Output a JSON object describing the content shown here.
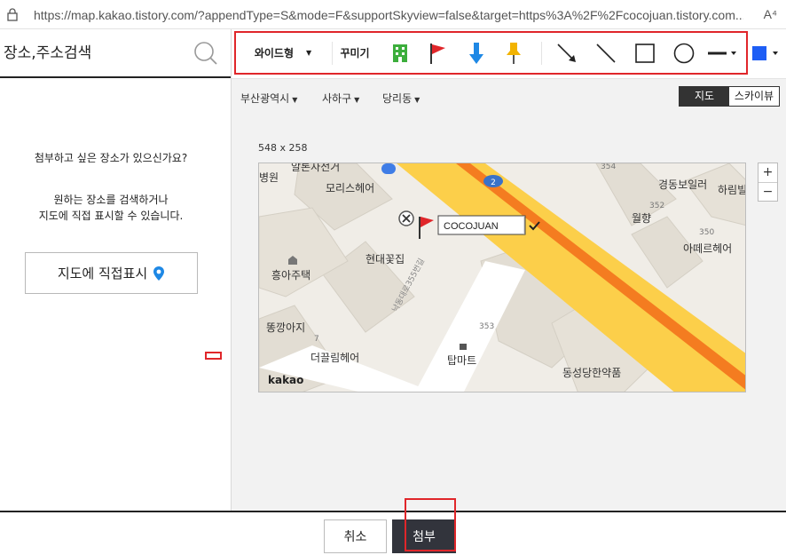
{
  "browser": {
    "url": "https://map.kakao.tistory.com/?appendType=S&mode=F&supportSkyview=false&target=https%3A%2F%2Fcocojuan.tistory.com...",
    "reader_label": "A⁴"
  },
  "search": {
    "placeholder": "장소,주소검색",
    "icon": "search-icon"
  },
  "left_panel": {
    "question": "첨부하고 싶은 장소가 있으신가요?",
    "hint_line1": "원하는 장소를 검색하거나",
    "hint_line2": "지도에 직접 표시할 수 있습니다.",
    "mark_button": "지도에 직접표시",
    "mark_icon": "location-pin-icon"
  },
  "toolbar": {
    "size_select": "와이드형",
    "decorate_label": "꾸미기",
    "tools": [
      "building-icon",
      "flag-icon",
      "arrow-down-icon",
      "pushpin-icon",
      "arrow-line-icon",
      "line-icon",
      "rectangle-icon",
      "circle-icon",
      "line-style-icon",
      "color-icon"
    ],
    "color": "#1e5ef5",
    "highlight_color": "#e0262a"
  },
  "region": {
    "city": "부산광역시",
    "district": "사하구",
    "dong": "당리동"
  },
  "map_type": {
    "map": "지도",
    "sky": "스카이뷰",
    "selected": "지도"
  },
  "map": {
    "size_label": "548 x 258",
    "marker_name": "COCOJUAN",
    "road_number": "2",
    "road_name": "낙동대로355번길",
    "logo": "kakao",
    "labels": [
      "알톤자전거",
      "병원",
      "모리스헤어",
      "현대꽃집",
      "흥아주택",
      "똥깡아지",
      "더끌림헤어",
      "탑마트",
      "동성당한약품",
      "경동보일러",
      "하림빌",
      "월향",
      "아떼르헤어"
    ],
    "numbers": [
      "354",
      "352",
      "350",
      "353",
      "7"
    ]
  },
  "zoom": {
    "in": "+",
    "out": "−"
  },
  "buttons": {
    "cancel": "취소",
    "attach": "첨부"
  }
}
